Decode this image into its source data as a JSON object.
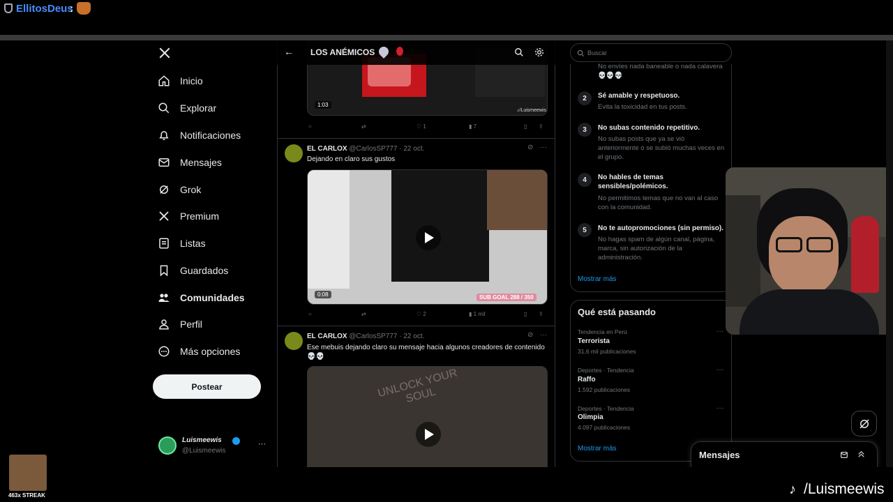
{
  "stream": {
    "username": "EllitosDeus",
    "colon": ":",
    "streak": "463x STREAK",
    "tiktok_handle": "/Luismeewis"
  },
  "nav": {
    "items": [
      {
        "label": "Inicio",
        "icon": "home-icon"
      },
      {
        "label": "Explorar",
        "icon": "search-icon"
      },
      {
        "label": "Notificaciones",
        "icon": "bell-icon"
      },
      {
        "label": "Mensajes",
        "icon": "mail-icon"
      },
      {
        "label": "Grok",
        "icon": "grok-icon"
      },
      {
        "label": "Premium",
        "icon": "x-icon"
      },
      {
        "label": "Listas",
        "icon": "list-icon"
      },
      {
        "label": "Guardados",
        "icon": "bookmark-icon"
      },
      {
        "label": "Comunidades",
        "icon": "communities-icon"
      },
      {
        "label": "Perfil",
        "icon": "person-icon"
      },
      {
        "label": "Más opciones",
        "icon": "more-circle-icon"
      }
    ],
    "post_label": "Postear",
    "profile_name": "Luismeewis",
    "profile_handle": "@Luismeewis",
    "profile_more": "···"
  },
  "header": {
    "title": "LOS ANÉMICOS",
    "back": "←"
  },
  "tweets": [
    {
      "duration": "1:03",
      "watermark": "♪/Luismeewis",
      "likes": "1",
      "views": "7"
    },
    {
      "name": "EL CARLOX",
      "handle": "@CarlosSP777",
      "date": "· 22 oct.",
      "text": "Dejando en claro sus gustos",
      "duration": "0:08",
      "overlay": "SUB GOAL",
      "overlay_count": "288 / 350",
      "likes": "2",
      "views": "1 mil"
    },
    {
      "name": "EL CARLOX",
      "handle": "@CarlosSP777",
      "date": "· 22 oct.",
      "text": "Ese mebuis dejando claro su mensaje hacia algunos creadores de contenido 💀💀",
      "graffiti": "UNLOCK YOUR SOUL"
    }
  ],
  "search": {
    "placeholder": "Buscar"
  },
  "rules": {
    "intro": "No envíes nada baneable o nada calavera 💀💀💀",
    "items": [
      {
        "num": "2",
        "title": "Sé amable y respetuoso.",
        "desc": "Evita la toxicidad en tus posts."
      },
      {
        "num": "3",
        "title": "No subas contenido repetitivo.",
        "desc": "No subas posts que ya se vió anteriormente o se subió muchas veces en el grupo."
      },
      {
        "num": "4",
        "title": "No hables de temas sensibles/polémicos.",
        "desc": "No permitimos temas que no van al caso con la comunidad."
      },
      {
        "num": "5",
        "title": "No te autopromociones (sin permiso).",
        "desc": "No hagas spam de algún canal, página, marca, sin autorización de la administración."
      }
    ],
    "more": "Mostrar más"
  },
  "trends": {
    "title": "Qué está pasando",
    "items": [
      {
        "meta": "Tendencia en Perú",
        "name": "Terrorista",
        "count": "31,6 mil publicaciones"
      },
      {
        "meta": "Deportes · Tendencia",
        "name": "Raffo",
        "count": "1.592 publicaciones"
      },
      {
        "meta": "Deportes · Tendencia",
        "name": "Olimpia",
        "count": "4.097 publicaciones"
      }
    ],
    "more": "Mostrar más"
  },
  "messages": {
    "label": "Mensajes"
  },
  "colors": {
    "accent": "#1d9bf0",
    "background": "#000000",
    "muted": "#71767b"
  }
}
